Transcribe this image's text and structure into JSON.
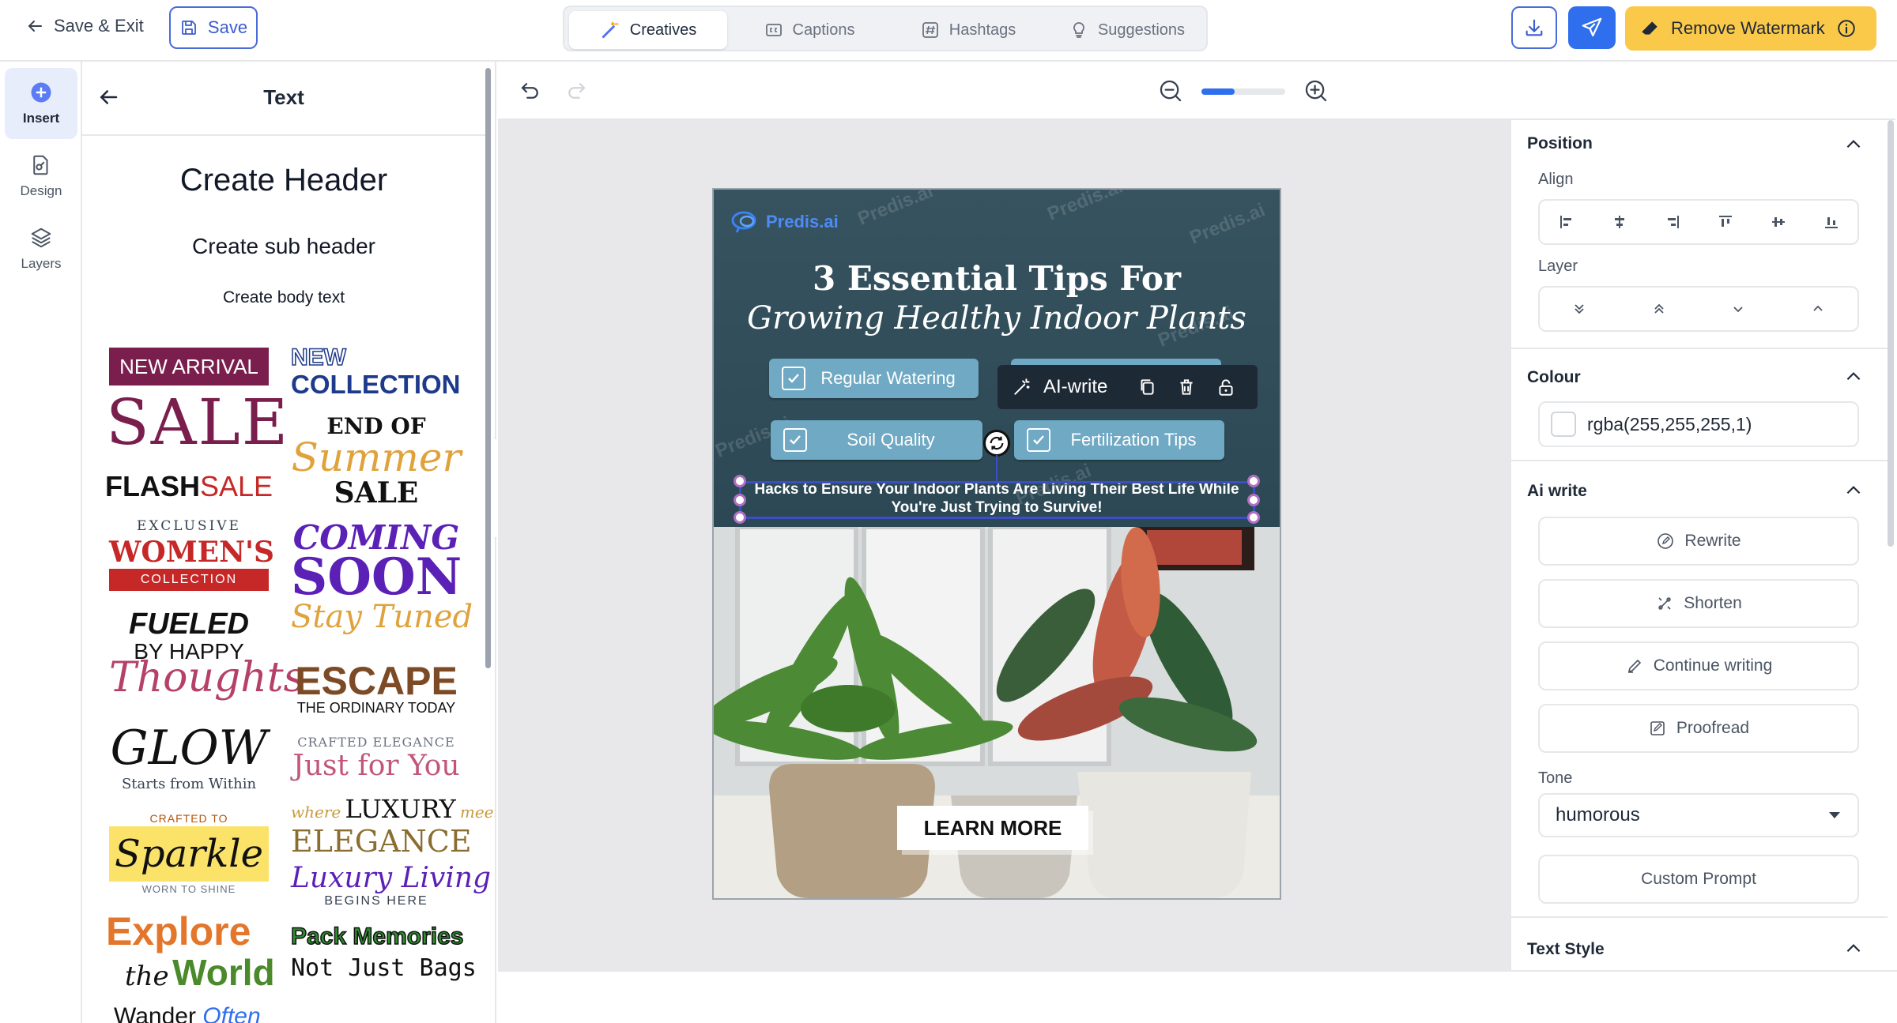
{
  "topbar": {
    "save_exit_label": "Save & Exit",
    "save_label": "Save",
    "tabs": [
      {
        "label": "Creatives",
        "icon": "wand-icon",
        "active": true
      },
      {
        "label": "Captions",
        "icon": "caption-icon",
        "active": false
      },
      {
        "label": "Hashtags",
        "icon": "hashtag-icon",
        "active": false
      },
      {
        "label": "Suggestions",
        "icon": "lightbulb-icon",
        "active": false
      }
    ],
    "remove_watermark_label": "Remove Watermark",
    "accent": "#2f6fee",
    "watermark_button_color": "#fbc94a"
  },
  "rail": {
    "items": [
      {
        "label": "Insert",
        "icon": "plus-circle-icon",
        "active": true
      },
      {
        "label": "Design",
        "icon": "design-icon",
        "active": false
      },
      {
        "label": "Layers",
        "icon": "layers-icon",
        "active": false
      }
    ]
  },
  "panel": {
    "title": "Text",
    "create_header": "Create Header",
    "create_sub_header": "Create sub header",
    "create_body_text": "Create body text",
    "samples": {
      "new_arrival": "NEW ARRIVAL",
      "sale": "SALE",
      "flash": "FLASH",
      "flash_sale": "SALE",
      "exclusive": "EXCLUSIVE",
      "womens": "WOMEN'S",
      "collection_small": "COLLECTION",
      "fueled": "FUELED",
      "by_happy": "BY HAPPY",
      "thoughts": "Thoughts",
      "glow": "GLOW",
      "starts_within": "Starts from Within",
      "crafted_to": "CRAFTED TO",
      "sparkle": "Sparkle",
      "worn_to_shine": "WORN TO SHINE",
      "explore": "Explore",
      "the": "the",
      "world": "World",
      "wander": "Wander",
      "often": "Often",
      "new": "NEW",
      "collection": "COLLECTION",
      "end_of": "END OF",
      "summer": "Summer",
      "sale2": "SALE",
      "coming": "COMING",
      "soon": "SOON",
      "stay_tuned": "Stay Tuned",
      "escape": "ESCAPE",
      "ordinary_today": "THE ORDINARY TODAY",
      "crafted_elegance": "CRAFTED ELEGANCE",
      "just_for_you": "Just for You",
      "where": "where",
      "luxury": "LUXURY",
      "meets": "meets",
      "elegance": "ELEGANCE",
      "luxury_living": "Luxury Living",
      "begins_here": "BEGINS HERE",
      "pack_memories": "Pack Memories",
      "not_just_bags": "Not Just Bags"
    }
  },
  "canvas": {
    "zoom_level": 0.4,
    "creative": {
      "brand": "Predis.ai",
      "watermark": "Predis.ai",
      "title_line1": "3 Essential Tips For",
      "title_line2": "Growing Healthy Indoor Plants",
      "chips": [
        "Regular Watering",
        "Soil Quality",
        "Fertilization Tips"
      ],
      "subtitle_line1": "Hacks to Ensure Your Indoor Plants Are Living Their Best Life While",
      "subtitle_line2": "You're Just Trying to Survive!",
      "cta": "LEARN MORE",
      "ai_write_label": "AI-write"
    }
  },
  "right": {
    "position_title": "Position",
    "align_label": "Align",
    "layer_label": "Layer",
    "colour_title": "Colour",
    "colour_value": "rgba(255,255,255,1)",
    "ai_write_title": "Ai write",
    "rewrite": "Rewrite",
    "shorten": "Shorten",
    "continue_writing": "Continue writing",
    "proofread": "Proofread",
    "tone_label": "Tone",
    "tone_value": "humorous",
    "custom_prompt": "Custom Prompt",
    "text_style_title": "Text Style"
  }
}
